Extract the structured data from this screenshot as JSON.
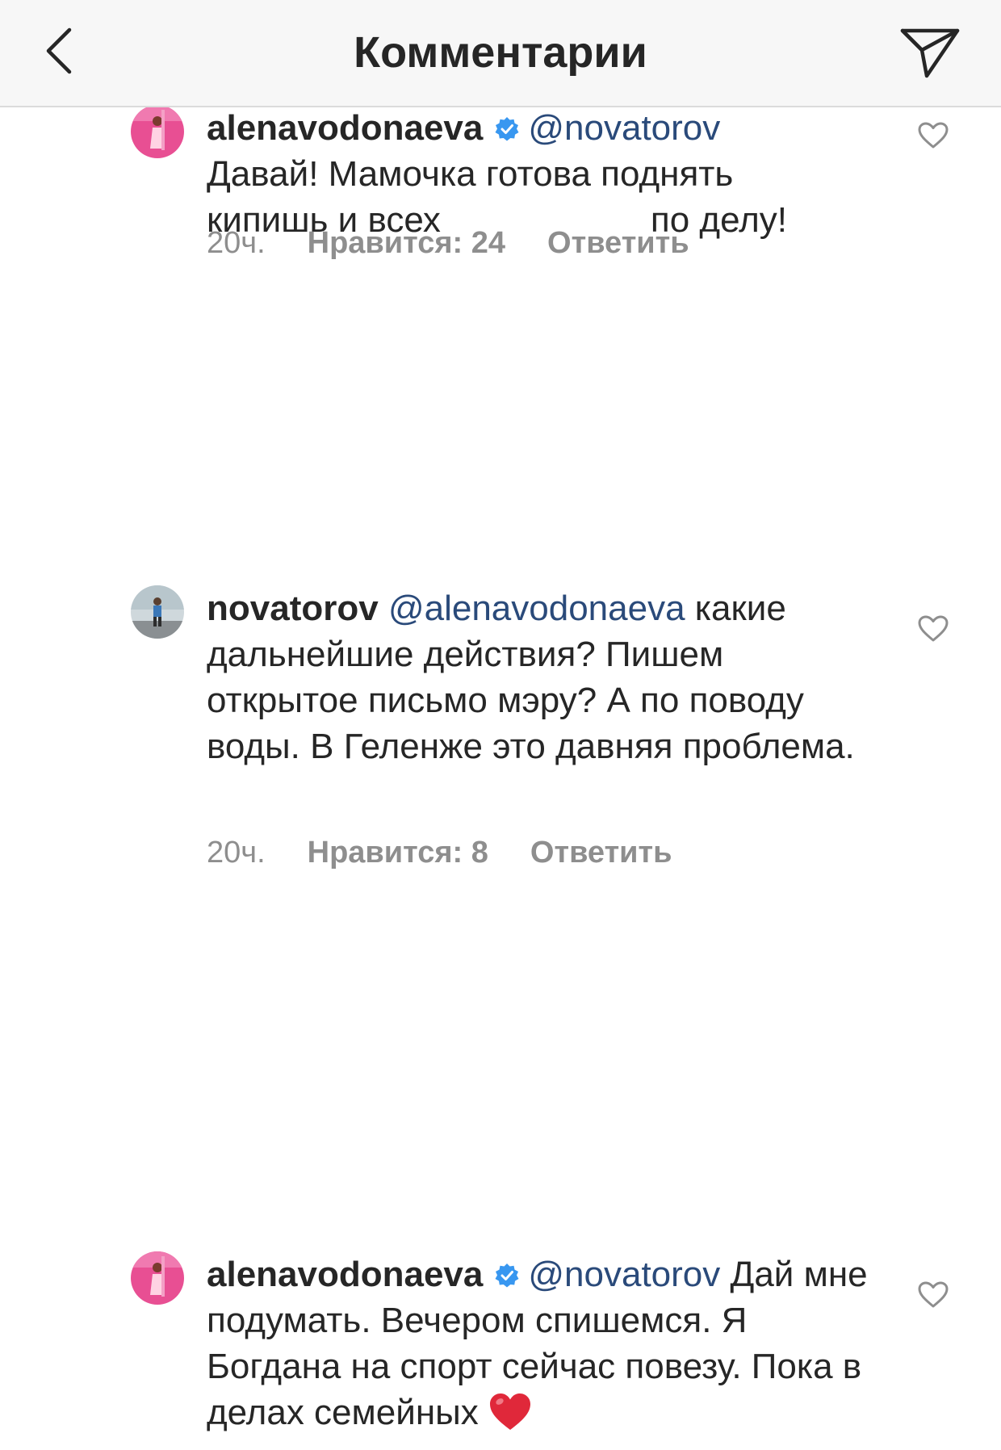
{
  "header": {
    "title": "Комментарии",
    "back_icon": "chevron-left-icon",
    "share_icon": "paper-plane-icon"
  },
  "comments": [
    {
      "username": "alenavodonaeva",
      "verified": true,
      "mention": "@novatorov",
      "text_line1": "Давай! Мамочка готова поднять",
      "text_line2_a": "кипишь и всех",
      "text_line2_b": "по делу!",
      "time": "20ч.",
      "likes": "Нравится: 24",
      "reply": "Ответить"
    },
    {
      "username": "novatorov",
      "verified": false,
      "mention": "@alenavodonaeva",
      "text_inline": "какие",
      "text_rest": "дальнейшие действия? Пишем открытое письмо мэру? А по поводу воды. В Геленже это давняя проблема.",
      "time": "20ч.",
      "likes": "Нравится: 8",
      "reply": "Ответить"
    },
    {
      "username": "alenavodonaeva",
      "verified": true,
      "mention": "@novatorov",
      "text_inline": "Дай",
      "text_rest": "мне подумать. Вечером спишемся. Я Богдана на спорт сейчас повезу. Пока в делах семейных"
    }
  ],
  "colors": {
    "text": "#262626",
    "mention": "#2a4a7a",
    "meta": "#8e8e8e",
    "verified": "#3897f0",
    "header_bg": "#f7f7f7"
  }
}
